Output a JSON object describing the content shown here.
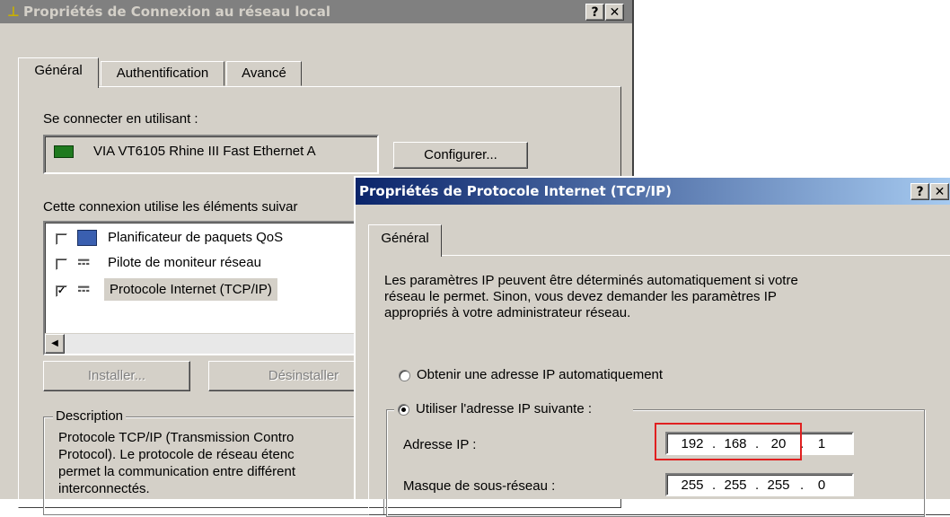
{
  "back_dialog": {
    "title": "Propriétés de Connexion au réseau local",
    "help_btn": "?",
    "close_btn": "✕",
    "tabs": [
      "Général",
      "Authentification",
      "Avancé"
    ],
    "connect_using_label": "Se connecter en utilisant :",
    "adapter_name": "VIA VT6105 Rhine III Fast Ethernet A",
    "configure_button": "Configurer...",
    "components_label": "Cette connexion utilise les éléments suivar",
    "components": [
      {
        "label": "Planificateur de paquets QoS",
        "checked": false,
        "icon": "network-scheduler-icon"
      },
      {
        "label": "Pilote de moniteur réseau",
        "checked": false,
        "icon": "network-protocol-icon"
      },
      {
        "label": "Protocole Internet (TCP/IP)",
        "checked": true,
        "icon": "network-protocol-icon"
      }
    ],
    "install_button": "Installer...",
    "uninstall_button": "Désinstaller",
    "description_legend": "Description",
    "description_lines": [
      "Protocole TCP/IP (Transmission Contro",
      "Protocol). Le protocole de réseau étenc",
      "permet la communication entre différent",
      "interconnectés."
    ]
  },
  "front_dialog": {
    "title": "Propriétés de Protocole Internet (TCP/IP)",
    "help_btn": "?",
    "close_btn": "✕",
    "tab": "Général",
    "info_lines": [
      "Les paramètres IP peuvent être déterminés automatiquement si votre",
      "réseau le permet. Sinon, vous devez demander les paramètres IP",
      "appropriés à votre administrateur réseau."
    ],
    "radio_auto": "Obtenir une adresse IP automatiquement",
    "radio_manual": "Utiliser l'adresse IP suivante :",
    "selected_radio": "manual",
    "ip_label": "Adresse IP :",
    "ip_octets": [
      "192",
      "168",
      "20",
      "1"
    ],
    "mask_label": "Masque de sous-réseau :",
    "mask_octets": [
      "255",
      "255",
      "255",
      "0"
    ],
    "highlight_color": "#e02020"
  },
  "colors": {
    "inactive_title_bg": "#808080",
    "inactive_title_text": "#d4d0c8",
    "active_title_start": "#0a246a",
    "active_title_end": "#a6caf0"
  }
}
